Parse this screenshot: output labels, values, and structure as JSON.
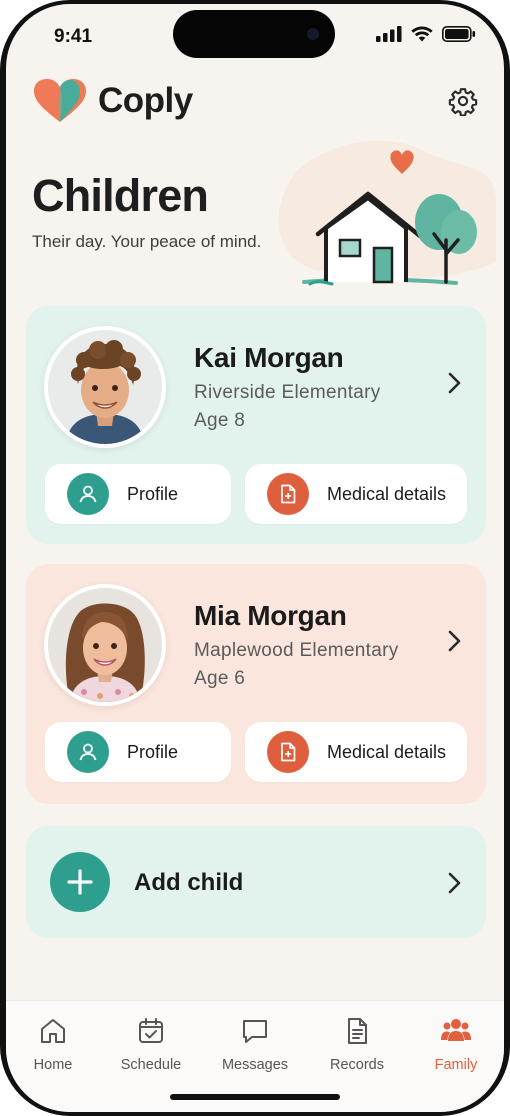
{
  "status_bar": {
    "time": "9:41"
  },
  "app": {
    "name": "Coply"
  },
  "page": {
    "title": "Children",
    "subtitle": "Their day. Your peace of mind."
  },
  "children": [
    {
      "name": "Kai Morgan",
      "school": "Riverside Elementary",
      "age": "Age 8",
      "profile_label": "Profile",
      "medical_label": "Medical details"
    },
    {
      "name": "Mia Morgan",
      "school": "Maplewood Elementary",
      "age": "Age 6",
      "profile_label": "Profile",
      "medical_label": "Medical details"
    }
  ],
  "add_child": {
    "label": "Add child"
  },
  "tabs": [
    {
      "label": "Home",
      "icon": "home-icon"
    },
    {
      "label": "Schedule",
      "icon": "calendar-icon"
    },
    {
      "label": "Messages",
      "icon": "chat-icon"
    },
    {
      "label": "Records",
      "icon": "document-icon"
    },
    {
      "label": "Family",
      "icon": "family-icon",
      "active": true
    }
  ],
  "colors": {
    "accent_teal": "#2e9f8f",
    "accent_orange": "#df5e3e",
    "card_teal_bg": "#e2f3ee",
    "card_peach_bg": "#fbe6dd",
    "active_tab": "#e0603f"
  }
}
